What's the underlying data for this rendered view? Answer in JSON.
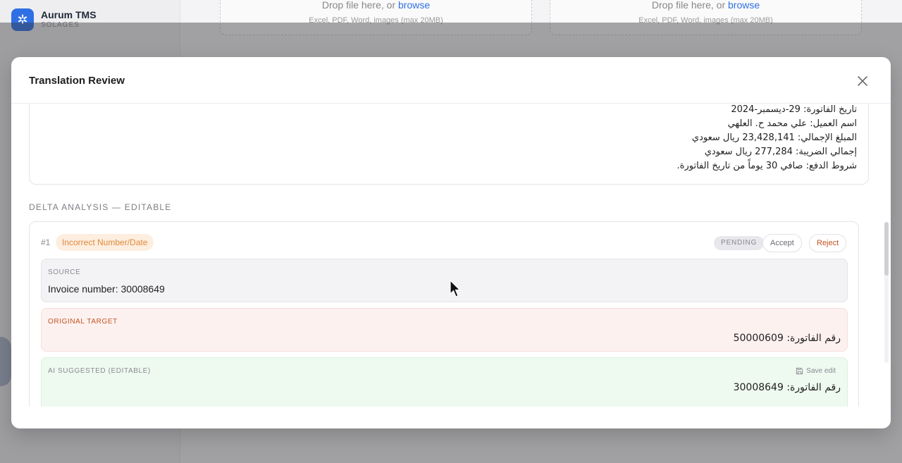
{
  "app": {
    "name": "Aurum TMS",
    "subtitle": "SOLAGES"
  },
  "background": {
    "drop_text": "Drop file here, or",
    "browse_label": "browse",
    "drop_hint": "Excel, PDF, Word, images (max 20MB)"
  },
  "modal": {
    "title": "Translation Review",
    "target_lines": [
      "تاريخ الفاتورة: 29-ديسمبر-2024",
      "اسم العميل: علي محمد ح. العلهي",
      "المبلغ الإجمالي: 23,428,141 ريال سعودي",
      "إجمالي الضريبة: 277,284 ريال سعودي",
      "شروط الدفع: صافي 30 يوماً من تاريخ الفاتورة."
    ],
    "section_label": "DELTA ANALYSIS — EDITABLE",
    "delta": {
      "number": "#1",
      "tag": "Incorrect Number/Date",
      "status": "PENDING",
      "accept_label": "Accept",
      "reject_label": "Reject",
      "source_label": "SOURCE",
      "source_value": "Invoice number: 30008649",
      "original_label": "ORIGINAL TARGET",
      "original_value": "رقم الفاتورة: 50000609",
      "suggested_label": "AI SUGGESTED (EDITABLE)",
      "suggested_value": "رقم الفاتورة: 30008649",
      "save_edit_label": "Save edit"
    }
  },
  "colors": {
    "accent": "#2f6fe4",
    "tag_bg": "#fdeee0",
    "tag_text": "#e08a3c",
    "reject": "#c2541f",
    "original_bg": "#fdf1f0",
    "suggested_bg": "#eefaf0"
  }
}
